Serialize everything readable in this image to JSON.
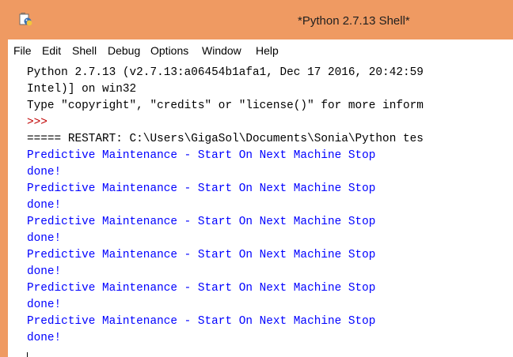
{
  "window": {
    "title": "*Python 2.7.13 Shell*",
    "titlebar_color": "#ef9a62",
    "icon": "idle-python-icon"
  },
  "menu": {
    "items": [
      "File",
      "Edit",
      "Shell",
      "Debug",
      "Options",
      "Window",
      "Help"
    ]
  },
  "shell": {
    "colors": {
      "stdout": "#0000ff",
      "prompt": "#c00000",
      "text": "#000000"
    },
    "lines": [
      {
        "text": "Python 2.7.13 (v2.7.13:a06454b1afa1, Dec 17 2016, 20:42:59",
        "kind": "text"
      },
      {
        "text": "Intel)] on win32",
        "kind": "text"
      },
      {
        "text": "Type \"copyright\", \"credits\" or \"license()\" for more inform",
        "kind": "text"
      },
      {
        "text": ">>>",
        "kind": "prompt"
      },
      {
        "text": "===== RESTART: C:\\Users\\GigaSol\\Documents\\Sonia\\Python tes",
        "kind": "text"
      },
      {
        "text": "Predictive Maintenance - Start On Next Machine Stop",
        "kind": "stdout"
      },
      {
        "text": "done!",
        "kind": "stdout"
      },
      {
        "text": "Predictive Maintenance - Start On Next Machine Stop",
        "kind": "stdout"
      },
      {
        "text": "done!",
        "kind": "stdout"
      },
      {
        "text": "Predictive Maintenance - Start On Next Machine Stop",
        "kind": "stdout"
      },
      {
        "text": "done!",
        "kind": "stdout"
      },
      {
        "text": "Predictive Maintenance - Start On Next Machine Stop",
        "kind": "stdout"
      },
      {
        "text": "done!",
        "kind": "stdout"
      },
      {
        "text": "Predictive Maintenance - Start On Next Machine Stop",
        "kind": "stdout"
      },
      {
        "text": "done!",
        "kind": "stdout"
      },
      {
        "text": "Predictive Maintenance - Start On Next Machine Stop",
        "kind": "stdout"
      },
      {
        "text": "done!",
        "kind": "stdout"
      }
    ]
  }
}
